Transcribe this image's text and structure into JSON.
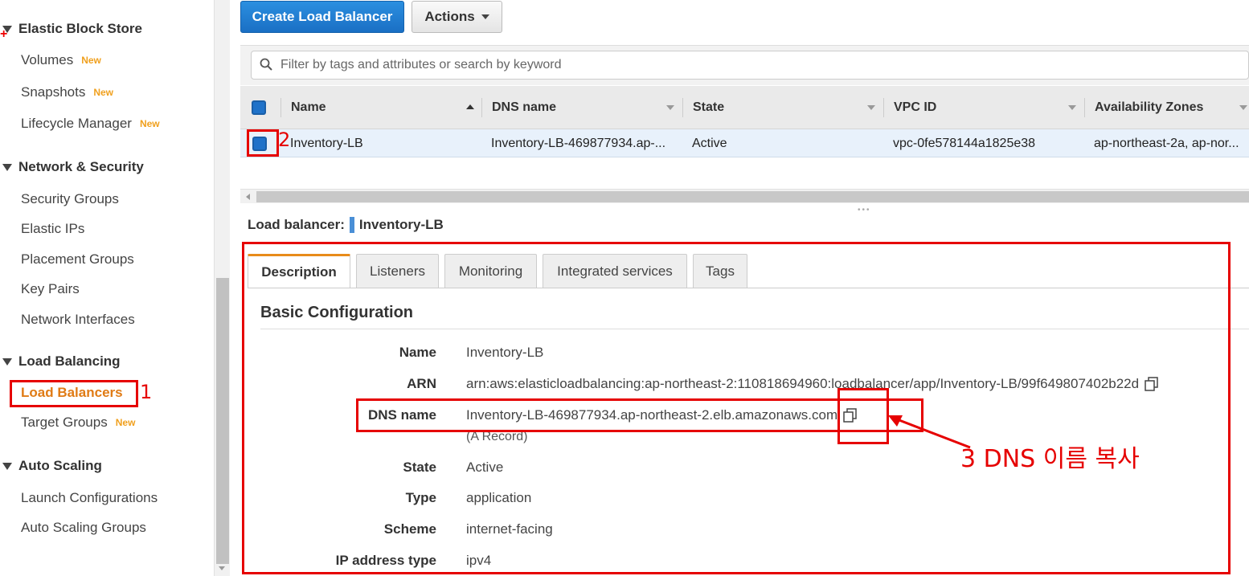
{
  "sidebar": {
    "sections": [
      {
        "label": "Elastic Block Store",
        "items": [
          {
            "label": "Volumes",
            "badge": "New"
          },
          {
            "label": "Snapshots",
            "badge": "New"
          },
          {
            "label": "Lifecycle Manager",
            "badge": "New"
          }
        ]
      },
      {
        "label": "Network & Security",
        "items": [
          {
            "label": "Security Groups"
          },
          {
            "label": "Elastic IPs"
          },
          {
            "label": "Placement Groups"
          },
          {
            "label": "Key Pairs"
          },
          {
            "label": "Network Interfaces"
          }
        ]
      },
      {
        "label": "Load Balancing",
        "items": [
          {
            "label": "Load Balancers",
            "active": true
          },
          {
            "label": "Target Groups",
            "badge": "New"
          }
        ]
      },
      {
        "label": "Auto Scaling",
        "items": [
          {
            "label": "Launch Configurations"
          },
          {
            "label": "Auto Scaling Groups"
          }
        ]
      }
    ]
  },
  "toolbar": {
    "create_label": "Create Load Balancer",
    "actions_label": "Actions"
  },
  "filter": {
    "placeholder": "Filter by tags and attributes or search by keyword"
  },
  "table": {
    "columns": [
      "Name",
      "DNS name",
      "State",
      "VPC ID",
      "Availability Zones"
    ],
    "rows": [
      {
        "name": "Inventory-LB",
        "dns": "Inventory-LB-469877934.ap-...",
        "state": "Active",
        "vpc": "vpc-0fe578144a1825e38",
        "az": "ap-northeast-2a, ap-nor..."
      }
    ]
  },
  "detail": {
    "title_prefix": "Load balancer:",
    "title_name": "Inventory-LB",
    "tabs": [
      "Description",
      "Listeners",
      "Monitoring",
      "Integrated services",
      "Tags"
    ],
    "active_tab": "Description",
    "section_title": "Basic Configuration",
    "fields": [
      {
        "label": "Name",
        "value": "Inventory-LB"
      },
      {
        "label": "ARN",
        "value": "arn:aws:elasticloadbalancing:ap-northeast-2:110818694960:loadbalancer/app/Inventory-LB/99f649807402b22d"
      },
      {
        "label": "DNS name",
        "value": "Inventory-LB-469877934.ap-northeast-2.elb.amazonaws.com",
        "sub": "(A Record)"
      },
      {
        "label": "State",
        "value": "Active"
      },
      {
        "label": "Type",
        "value": "application"
      },
      {
        "label": "Scheme",
        "value": "internet-facing"
      },
      {
        "label": "IP address type",
        "value": "ipv4"
      }
    ]
  },
  "annotations": {
    "step1": "1",
    "step2": "2",
    "step3": "3 DNS 이름 복사",
    "color": "#e60000"
  }
}
